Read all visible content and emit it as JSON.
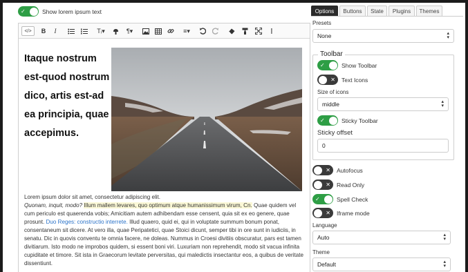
{
  "top_toggle": {
    "label": "Show lorem ipsum text",
    "on": true
  },
  "toolbar": {
    "source": "</>",
    "bold": "B",
    "italic": "I",
    "font_size": "Tᵢ▾",
    "paragraph": "¶▾",
    "align": "≡▾",
    "more": "⋮"
  },
  "content": {
    "heading": "Itaque nostrum est-quod nostrum dico, artis est-ad ea principia, quae accepimus.",
    "p_start": "Lorem ipsum dolor sit amet, consectetur adipiscing elit.",
    "p_italic": "Quonam, inquit, modo?",
    "p_highlight": "Illum mallem levares, quo optimum atque humanissimum virum, Cn.",
    "p_mid": "Quae quidem vel cum periculo est quaerenda vobis; Amicitiam autem adhibendam esse censent, quia sit ex eo genere, quae prosunt.",
    "p_link": "Duo Reges: constructio interrete.",
    "p_end": "Illud quaero, quid ei, qui in voluptate summum bonum ponat, consentaneum sit dicere. At vero illa, quae Peripatetici, quae Stoici dicunt, semper tibi in ore sunt in iudiciis, in senatu. Dic in quovis conventu te omnia facere, ne doleas. Nummus in Croesi divitiis obscuratur, pars est tamen divitiarum. Isto modo ne improbos quidem, si essent boni viri. Luxuriam non reprehendit, modo sit vacua infinita cupiditate et timore. Sit ista in Graecorum levitate perversitas, qui maledictis insectantur eos, a quibus de veritate dissentiunt."
  },
  "tabs": [
    "Options",
    "Buttons",
    "State",
    "Plugins",
    "Themes"
  ],
  "active_tab": "Options",
  "presets": {
    "label": "Presets",
    "value": "None"
  },
  "toolbar_group": {
    "legend": "Toolbar",
    "show_toolbar": {
      "label": "Show Toolbar",
      "on": true
    },
    "text_icons": {
      "label": "Text Icons",
      "on": false
    },
    "size_label": "Size of icons",
    "size_value": "middle",
    "sticky_toolbar": {
      "label": "Sticky Toolbar",
      "on": true
    },
    "sticky_offset_label": "Sticky offset",
    "sticky_offset_value": "0"
  },
  "autofocus": {
    "label": "Autofocus",
    "on": false
  },
  "read_only": {
    "label": "Read Only",
    "on": false
  },
  "spell_check": {
    "label": "Spell Check",
    "on": true
  },
  "iframe_mode": {
    "label": "Iframe mode",
    "on": false
  },
  "language": {
    "label": "Language",
    "value": "Auto"
  },
  "theme": {
    "label": "Theme",
    "value": "Default"
  },
  "colors": {
    "toggle_on": "#2e9e45",
    "toggle_off": "#3a3a3a",
    "link": "#2a72c8",
    "highlight": "#fbf8d6"
  }
}
